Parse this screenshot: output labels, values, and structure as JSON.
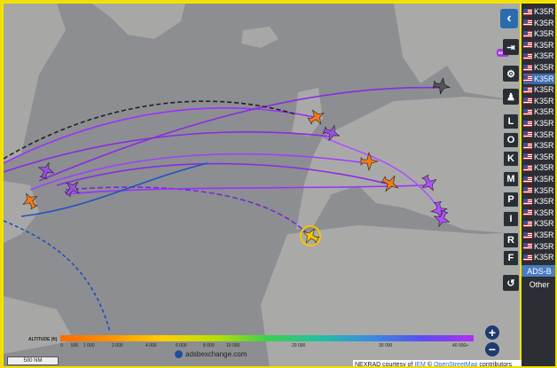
{
  "controls": {
    "collapse_icon": "chevron-left",
    "beta_badge": "BETA",
    "buttons": [
      "L",
      "O",
      "K",
      "M",
      "P",
      "I",
      "R",
      "F"
    ]
  },
  "aircraft_list": {
    "items": [
      {
        "label": "K35R"
      },
      {
        "label": "K35R"
      },
      {
        "label": "K35R"
      },
      {
        "label": "K35R"
      },
      {
        "label": "K35R"
      },
      {
        "label": "K35R"
      },
      {
        "label": "K35R"
      },
      {
        "label": "K35R"
      },
      {
        "label": "K35R"
      },
      {
        "label": "K35R"
      },
      {
        "label": "K35R"
      },
      {
        "label": "K35R"
      },
      {
        "label": "K35R"
      },
      {
        "label": "K35R"
      },
      {
        "label": "K35R"
      },
      {
        "label": "K35R"
      },
      {
        "label": "K35R"
      },
      {
        "label": "K35R"
      },
      {
        "label": "K35R"
      },
      {
        "label": "K35R"
      },
      {
        "label": "K35R"
      },
      {
        "label": "K35R"
      },
      {
        "label": "K35R"
      }
    ],
    "selected_index": 6
  },
  "source_filter": {
    "adsb": "ADS-B",
    "other": "Other"
  },
  "zoom": {
    "in": "+",
    "out": "−"
  },
  "legend": {
    "title": "ALTITUDE (ft)",
    "ticks": [
      "0",
      "500",
      "1 000",
      "2 000",
      "4 000",
      "6 000",
      "8 000",
      "10 000",
      "20 000",
      "30 000",
      "40 000+"
    ]
  },
  "brand": "adsbexchange.com",
  "credits": {
    "prefix": "NEXRAD courtesy of",
    "iem": "IEM",
    "sep": "©",
    "osm": "OpenStreetMap",
    "suffix": "contributors"
  },
  "scale": "500 NM",
  "colors": {
    "track_purple": "#8a2be2",
    "plane_orange": "#f07a1a",
    "plane_purple": "#9b4de0",
    "sea": "#8c8e91",
    "land": "#a9aaa8"
  }
}
